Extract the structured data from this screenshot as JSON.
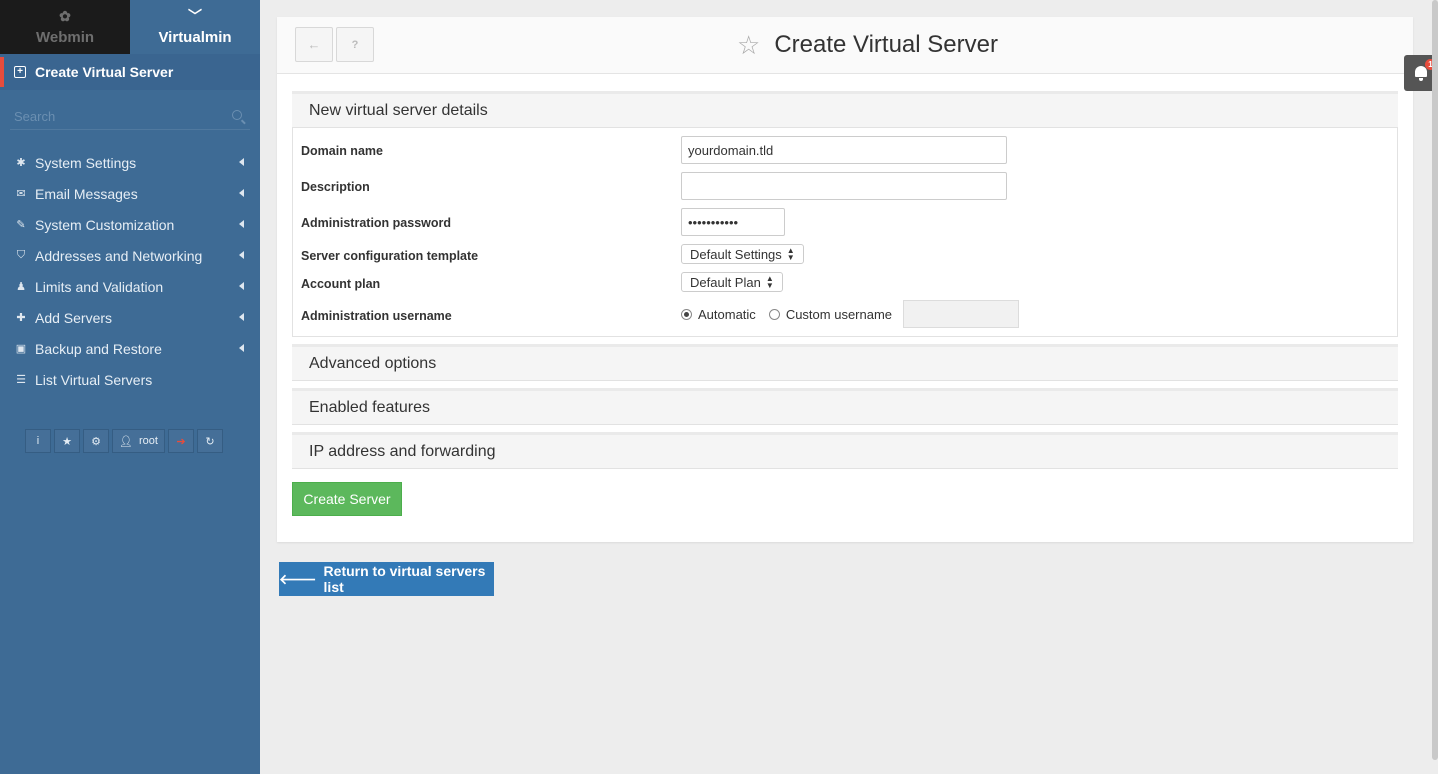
{
  "sidebar": {
    "tabs": [
      {
        "label": "Webmin",
        "icon": "webmin-logo-icon"
      },
      {
        "label": "Virtualmin",
        "icon": "chevron-down-icon"
      }
    ],
    "current": {
      "label": "Create Virtual Server",
      "icon": "plus-square-icon"
    },
    "search": {
      "placeholder": "Search"
    },
    "items": [
      {
        "label": "System Settings",
        "icon": "gear-icon"
      },
      {
        "label": "Email Messages",
        "icon": "envelope-icon"
      },
      {
        "label": "System Customization",
        "icon": "wrench-icon"
      },
      {
        "label": "Addresses and Networking",
        "icon": "shield-icon"
      },
      {
        "label": "Limits and Validation",
        "icon": "user-tie-icon"
      },
      {
        "label": "Add Servers",
        "icon": "plus-icon"
      },
      {
        "label": "Backup and Restore",
        "icon": "floppy-icon"
      },
      {
        "label": "List Virtual Servers",
        "icon": "list-icon"
      }
    ],
    "toolbar": {
      "user_label": "root"
    }
  },
  "header": {
    "title": "Create Virtual Server"
  },
  "form": {
    "section_title": "New virtual server details",
    "domain": {
      "label": "Domain name",
      "value": "yourdomain.tld"
    },
    "description": {
      "label": "Description",
      "value": ""
    },
    "password": {
      "label": "Administration password",
      "value": "•••••••••••"
    },
    "template": {
      "label": "Server configuration template",
      "value": "Default Settings"
    },
    "plan": {
      "label": "Account plan",
      "value": "Default Plan"
    },
    "username": {
      "label": "Administration username",
      "option_auto": "Automatic",
      "option_custom": "Custom username",
      "selected": "Automatic"
    }
  },
  "sections": {
    "advanced": "Advanced options",
    "features": "Enabled features",
    "ip": "IP address and forwarding"
  },
  "buttons": {
    "create": "Create Server",
    "return": "Return to virtual servers list"
  },
  "notifications": {
    "count": "1"
  },
  "colors": {
    "sidebar": "#3e6b95",
    "accent_red": "#e74c3c",
    "create_green": "#5cb85c",
    "return_blue": "#337ab7"
  }
}
